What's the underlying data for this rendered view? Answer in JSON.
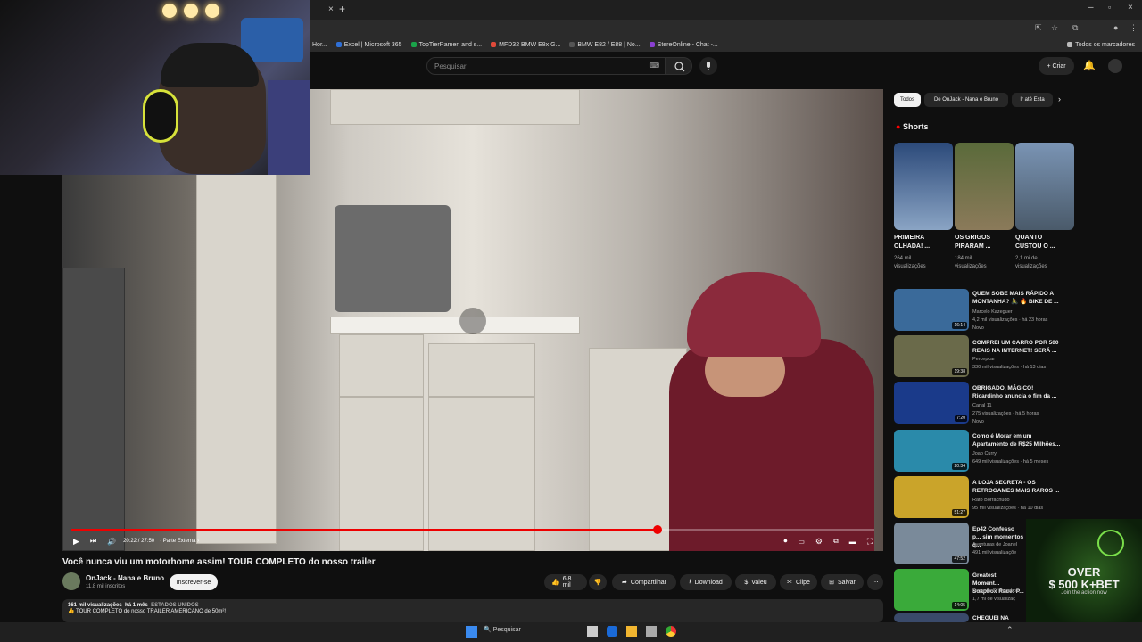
{
  "browser": {
    "bookmarks": [
      "Hor...",
      "Excel | Microsoft 365",
      "TopTierRamen and s...",
      "MFD32 BMW E8x G...",
      "BMW E82 / E88 | No...",
      "StereOnline - Chat -..."
    ],
    "all_bookmarks": "Todos os marcadores"
  },
  "youtube": {
    "search_placeholder": "Pesquisar",
    "create_label": "Criar"
  },
  "video": {
    "time": "20:22 / 27:50",
    "chapter": "Parte Externa",
    "progress": 0.73,
    "title": "Você nunca viu um motorhome assim! TOUR COMPLETO do nosso trailer",
    "channel": "OnJack - Nana e Bruno",
    "subscribers": "11,8 mil inscritos",
    "subscribe_label": "Inscrever-se",
    "likes": "6,8 mil",
    "share_label": "Compartilhar",
    "download_label": "Download",
    "thanks_label": "Valeu",
    "clip_label": "Clipe",
    "save_label": "Salvar",
    "views": "161 mil visualizações",
    "age": "há 1 mês",
    "location": "ESTADOS UNIDOS",
    "desc_line": "👍 TOUR COMPLETO do nosso TRAILER AMERICANO de 50m²!"
  },
  "sidebar": {
    "chips": [
      "Todos",
      "De OnJack - Nana e Bruno",
      "Ir até Esta"
    ],
    "shorts_title": "Shorts",
    "shorts": [
      {
        "title": "PRIMEIRA OLHADA! ...",
        "views1": "264 mil",
        "views2": "visualizações"
      },
      {
        "title": "OS GRIGOS PIRARAM ...",
        "views1": "184 mil",
        "views2": "visualizações"
      },
      {
        "title": "QUANTO CUSTOU O ...",
        "views1": "2,1 mi de",
        "views2": "visualizações"
      }
    ],
    "videos": [
      {
        "title": "QUEM SOBE MAIS RÁPIDO A MONTANHA? 🚴 🔥 BIKE DE ...",
        "channel": "Marcelo Kazeguer",
        "meta": "4,2 mil visualizações · há 23 horas",
        "badge": "Novo",
        "duration": "16:14"
      },
      {
        "title": "COMPREI UM CARRO POR 500 REAIS NA INTERNET! SERÁ ...",
        "channel": "Percepcar",
        "meta": "330 mil visualizações · há 13 dias",
        "badge": "",
        "duration": "19:38"
      },
      {
        "title": "OBRIGADO, MÁGICO! Ricardinho anuncia o fim da ...",
        "channel": "Canal 11",
        "meta": "275 visualizações · há 5 horas",
        "badge": "Novo",
        "duration": "7:20"
      },
      {
        "title": "Como é Morar em um Apartamento de R$25 Milhões...",
        "channel": "Joao Curry",
        "meta": "649 mil visualizações · há 5 meses",
        "badge": "",
        "duration": "20:34"
      },
      {
        "title": "A LOJA SECRETA - OS RETROGAMES MAIS RAROS ...",
        "channel": "Rato Borrachudo",
        "meta": "95 mil visualizações · há 10 dias",
        "badge": "",
        "duration": "51:27"
      },
      {
        "title": "Ep42 Confesso p... sim momentos q...",
        "channel": "Aventuras de Joanel",
        "meta": "491 mil visualizaçõe",
        "badge": "",
        "duration": "47:52"
      },
      {
        "title": "Greatest Moment... Soapbox Race: P...",
        "channel": "Legends Of Soapbox",
        "meta": "1,7 mi de visualizaç",
        "badge": "",
        "duration": "14:05"
      },
      {
        "title": "CHEGUEI NA CAR...",
        "channel": "",
        "meta": "",
        "badge": "",
        "duration": ""
      }
    ]
  },
  "ad": {
    "line1": "OVER",
    "line2": "$ 500 K+BET",
    "line3": "Join the action now"
  },
  "taskbar": {
    "search": "Pesquisar"
  }
}
